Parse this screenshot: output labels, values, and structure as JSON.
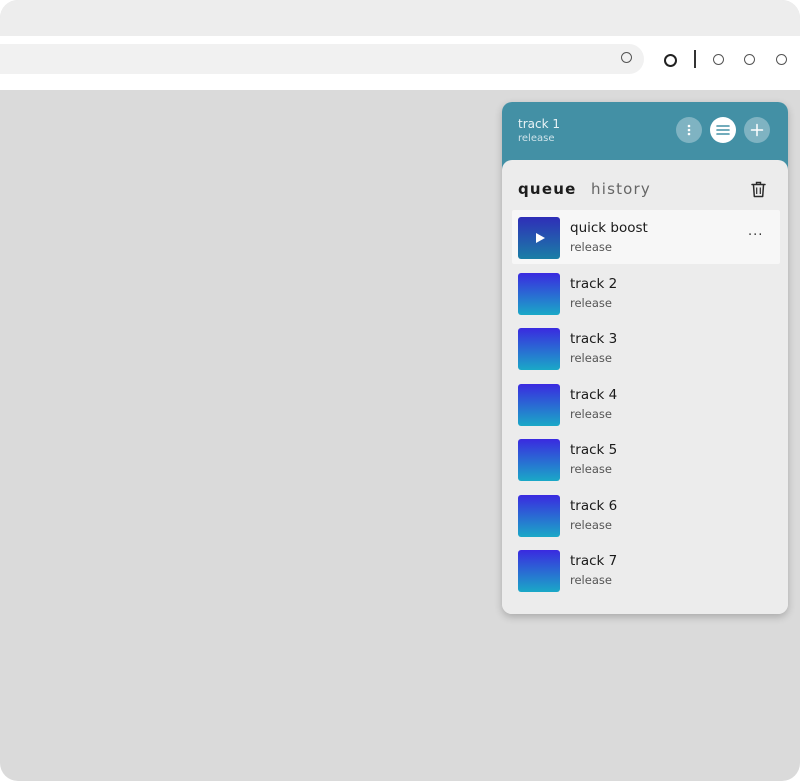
{
  "browser": {
    "url_text": ""
  },
  "player": {
    "now_playing": {
      "title": "track 1",
      "subtitle": "release"
    },
    "header_buttons": [
      {
        "icon": "more-vertical-icon"
      },
      {
        "icon": "queue-list-icon",
        "active": true
      },
      {
        "icon": "plus-icon"
      }
    ],
    "tabs": {
      "queue": "queue",
      "history": "history"
    },
    "queue": [
      {
        "title": "quick boost",
        "subtitle": "release",
        "playing": true,
        "more": "···"
      },
      {
        "title": "track 2",
        "subtitle": "release"
      },
      {
        "title": "track 3",
        "subtitle": "release"
      },
      {
        "title": "track 4",
        "subtitle": "release"
      },
      {
        "title": "track 5",
        "subtitle": "release"
      },
      {
        "title": "track 6",
        "subtitle": "release"
      },
      {
        "title": "track 7",
        "subtitle": "release"
      }
    ]
  },
  "colors": {
    "header": "#4390a5",
    "thumb_top": "#3a2ae0",
    "thumb_bottom": "#1aa9c7",
    "desktop": "#dadada"
  }
}
